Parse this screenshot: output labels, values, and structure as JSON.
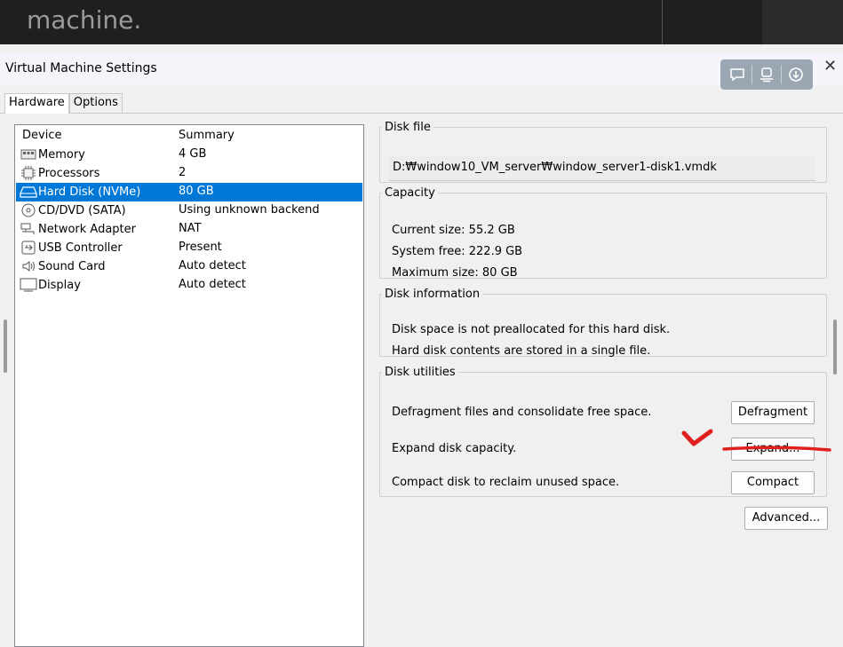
{
  "banner": {
    "caption": "machine."
  },
  "window": {
    "title": "Virtual Machine Settings"
  },
  "overlay_icons": [
    "comment-icon",
    "monitor-icon",
    "download-icon"
  ],
  "tabs": [
    {
      "label": "Hardware",
      "active": true
    },
    {
      "label": "Options",
      "active": false
    }
  ],
  "device_list": {
    "headers": {
      "device": "Device",
      "summary": "Summary"
    },
    "rows": [
      {
        "icon": "memory-icon",
        "device": "Memory",
        "summary": "4 GB",
        "selected": false
      },
      {
        "icon": "processor-icon",
        "device": "Processors",
        "summary": "2",
        "selected": false
      },
      {
        "icon": "hard-disk-icon",
        "device": "Hard Disk (NVMe)",
        "summary": "80 GB",
        "selected": true
      },
      {
        "icon": "cd-dvd-icon",
        "device": "CD/DVD (SATA)",
        "summary": "Using unknown backend",
        "selected": false
      },
      {
        "icon": "network-adapter-icon",
        "device": "Network Adapter",
        "summary": "NAT",
        "selected": false
      },
      {
        "icon": "usb-controller-icon",
        "device": "USB Controller",
        "summary": "Present",
        "selected": false
      },
      {
        "icon": "sound-card-icon",
        "device": "Sound Card",
        "summary": "Auto detect",
        "selected": false
      },
      {
        "icon": "display-icon",
        "device": "Display",
        "summary": "Auto detect",
        "selected": false
      }
    ]
  },
  "disk_file": {
    "legend": "Disk file",
    "path": "D:₩window10_VM_server₩window_server1-disk1.vmdk"
  },
  "capacity": {
    "legend": "Capacity",
    "current": "Current size: 55.2 GB",
    "system_free": "System free: 222.9 GB",
    "maximum": "Maximum size: 80 GB"
  },
  "disk_info": {
    "legend": "Disk information",
    "line1": "Disk space is not preallocated for this hard disk.",
    "line2": "Hard disk contents are stored in a single file."
  },
  "disk_utilities": {
    "legend": "Disk utilities",
    "defrag_text": "Defragment files and consolidate free space.",
    "defrag_button": "Defragment",
    "expand_text": "Expand disk capacity.",
    "expand_button": "Expand...",
    "compact_text": "Compact disk to reclaim unused space.",
    "compact_button": "Compact"
  },
  "advanced_button": "Advanced...",
  "annotation_color": "#e0201e",
  "selection_color": "#0078d7"
}
